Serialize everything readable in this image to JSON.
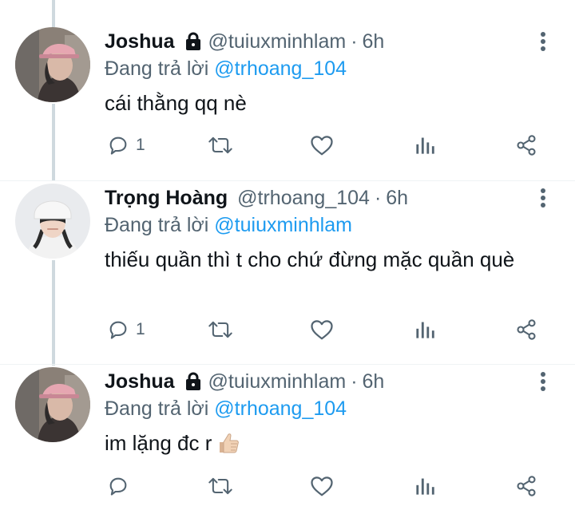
{
  "tweets": [
    {
      "name": "Joshua",
      "locked": true,
      "handle": "@tuiuxminhlam",
      "separator": "·",
      "time": "6h",
      "reply_prefix": "Đang trả lời",
      "reply_to": "@trhoang_104",
      "text": "cái thằng qq nè",
      "reply_count": "1",
      "avatar_icon": "profile-photo-pink-cap",
      "icons": [
        "comment-icon",
        "retweet-icon",
        "heart-icon",
        "analytics-icon",
        "share-icon",
        "more-vertical-icon"
      ]
    },
    {
      "name": "Trọng Hoàng",
      "locked": false,
      "handle": "@trhoang_104",
      "separator": "·",
      "time": "6h",
      "reply_prefix": "Đang trả lời",
      "reply_to": "@tuiuxminhlam",
      "text": "thiếu quần thì t cho chứ đừng mặc quần què",
      "reply_count": "1",
      "avatar_icon": "profile-photo-white-beanie",
      "icons": [
        "comment-icon",
        "retweet-icon",
        "heart-icon",
        "analytics-icon",
        "share-icon",
        "more-vertical-icon"
      ]
    },
    {
      "name": "Joshua",
      "locked": true,
      "handle": "@tuiuxminhlam",
      "separator": "·",
      "time": "6h",
      "reply_prefix": "Đang trả lời",
      "reply_to": "@trhoang_104",
      "text": "im lặng đc r",
      "text_emoji": "thumbs-up",
      "reply_count": "",
      "avatar_icon": "profile-photo-pink-cap",
      "icons": [
        "comment-icon",
        "retweet-icon",
        "heart-icon",
        "analytics-icon",
        "share-icon",
        "more-vertical-icon"
      ]
    }
  ],
  "colors": {
    "text": "#0f1419",
    "secondary": "#536471",
    "accent": "#1d9bf0",
    "thread_line": "#cfd9de"
  }
}
